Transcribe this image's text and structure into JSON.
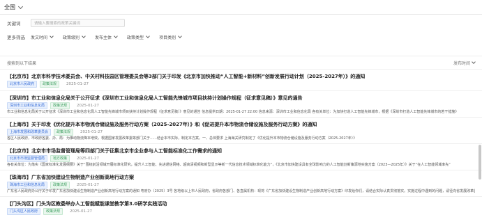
{
  "topbar": {
    "region": "全国"
  },
  "filters": {
    "keyword_label": "关键词",
    "keyword_placeholder": "请输入要搜索的政策关键词",
    "more_label": "更多筛选",
    "options": [
      "发文时间",
      "政策级别",
      "发布主体",
      "政策类型",
      "项目类别"
    ]
  },
  "results": {
    "header": "搜索到以下结果",
    "sort": "发布时间"
  },
  "items": [
    {
      "title": "【北京市】北京市科学技术委员会、中关村科技园区管理委员会等3部门关于印发《北京市加快推动“人工智能+新材料”创新发展行动计划（2025-2027年）》的通知",
      "tags": [
        {
          "text": "北京市人民政府",
          "style": "blue"
        },
        {
          "text": "政策法规",
          "style": "green"
        }
      ],
      "date": "2025-01-27",
      "summary": ""
    },
    {
      "title": "【深圳市】市工业和信息化局关于公开征求《深圳市工业和信息化局人工智能先锋城市项目扶持计划操作规程（征求意见稿）》意见的通告",
      "tags": [
        {
          "text": "深圳市工业和信息化局",
          "style": "blue"
        },
        {
          "text": "政策法规",
          "style": "green"
        }
      ],
      "date": "2025-01-27",
      "summary": "市工业和信息化局关于公开征求《深圳市工业和信息化局人工智能先锋城市项目扶持计划操作规程（征求意见稿）》意见的通告 信息提供日期：2025-01-27 22:00 信息来源：深圳市工业和信息化局 各有关单位：为加快打造人工智能先锋城市，根据《深圳市打造人工智能先锋城市的若干措施》"
    },
    {
      "title": "【上海市】关于印发《优化提升本市物流仓储设施及服务行动方案（2025-2027年）》和《促进提升本市物流仓储设施及服务行动方案》的通知",
      "tags": [
        {
          "text": "上海市发展和改革委员会",
          "style": "blue"
        },
        {
          "text": "政策法规",
          "style": "green"
        }
      ],
      "date": "2025-01-27",
      "summary": "各区人民政府，市政府各委、办、局：为推动物流降本增效，根据国家发展改革委等部门关于……结合本市实际，制定本方案。一、总体要求 上海海关研究制定了《优化提升本市物流仓储设施及服务行动方案（2025-2027年）》"
    },
    {
      "title": "【北京市】北京市市场监督管理局等四部门关于征集北京市企业参与人工智能标准化工作需求的通知",
      "tags": [
        {
          "text": "北京市市场监督管理局",
          "style": "blue"
        },
        {
          "text": "地方政策",
          "style": "green"
        }
      ],
      "date": "2025-01-27",
      "summary": "各有关单位：为落实《国家标准化发展纲要》关于“围绕前沿领域开展标准化研究，提升人工智能、先进通信网络、超高清视频和新型显示等新一代信息技术领域标准化能力”，《北京市加快建设具有全球影响力的人工智能创新策源地实施方案（2023—2025年）》关于“在人工智能领域率先”"
    },
    {
      "title": "【珠海市】广东省加快建设生物制造产业创新高地行动方案",
      "tags": [
        {
          "text": "珠海市工业和信息化局",
          "style": "blue"
        },
        {
          "text": "政策法规",
          "style": "green"
        }
      ],
      "date": "2025-01-27",
      "summary": "广东省人民政府办公厅关于印发广东省加快建设生物制造产业创新高地行动方案的通知 粤府办〔2025〕3号 各地级以上市人民政府，省政府各部门、各直属机构：现将《广东省加快建设生物制造产业创新高地行动方案》印发给你们，请结合实际认真贯彻落实。实施过程中遇到的问题，请径向省发展改革委反映。省政府办公厅2025年1月22日 广东省加快建设生物制造产业创新高地行动方案"
    },
    {
      "title": "【门头沟区】门头沟区教委举办人工智能赋能课堂教学第3.0研学实践活动",
      "tags": [
        {
          "text": "门头沟区人民政府",
          "style": "blue"
        },
        {
          "text": "政策法规",
          "style": "green"
        }
      ],
      "date": "2025-01-27",
      "summary": ""
    }
  ]
}
